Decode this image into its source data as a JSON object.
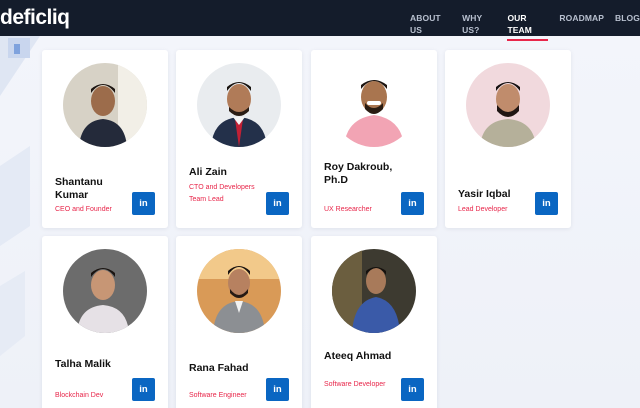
{
  "brand": {
    "logo_text": "deficliq",
    "accent": "#e8264a",
    "nav_bg": "#141c2b",
    "linkedin_color": "#0a66c2"
  },
  "nav": {
    "links": [
      "ABOUT US",
      "WHY US?",
      "OUR TEAM",
      "ROADMAP",
      "BLOG"
    ],
    "active": "OUR TEAM"
  },
  "team": [
    {
      "name": "Shantanu Kumar",
      "role": "CEO and Founder",
      "social_icon": "linkedin-icon",
      "social_label": "in"
    },
    {
      "name": "Ali Zain",
      "role": "CTO and Developers Team Lead",
      "social_icon": "linkedin-icon",
      "social_label": "in"
    },
    {
      "name": "Roy Dakroub, Ph.D",
      "role": "UX Researcher",
      "social_icon": "linkedin-icon",
      "social_label": "in"
    },
    {
      "name": "Yasir Iqbal",
      "role": "Lead Developer",
      "social_icon": "linkedin-icon",
      "social_label": "in"
    },
    {
      "name": "Talha Malik",
      "role": "Blockchain Dev",
      "social_icon": "linkedin-icon",
      "social_label": "in"
    },
    {
      "name": "Rana Fahad",
      "role": "Software Engineer",
      "social_icon": "linkedin-icon",
      "social_label": "in"
    },
    {
      "name": "Ateeq Ahmad",
      "role": "Software Developer",
      "social_icon": "linkedin-icon",
      "social_label": "in"
    }
  ]
}
